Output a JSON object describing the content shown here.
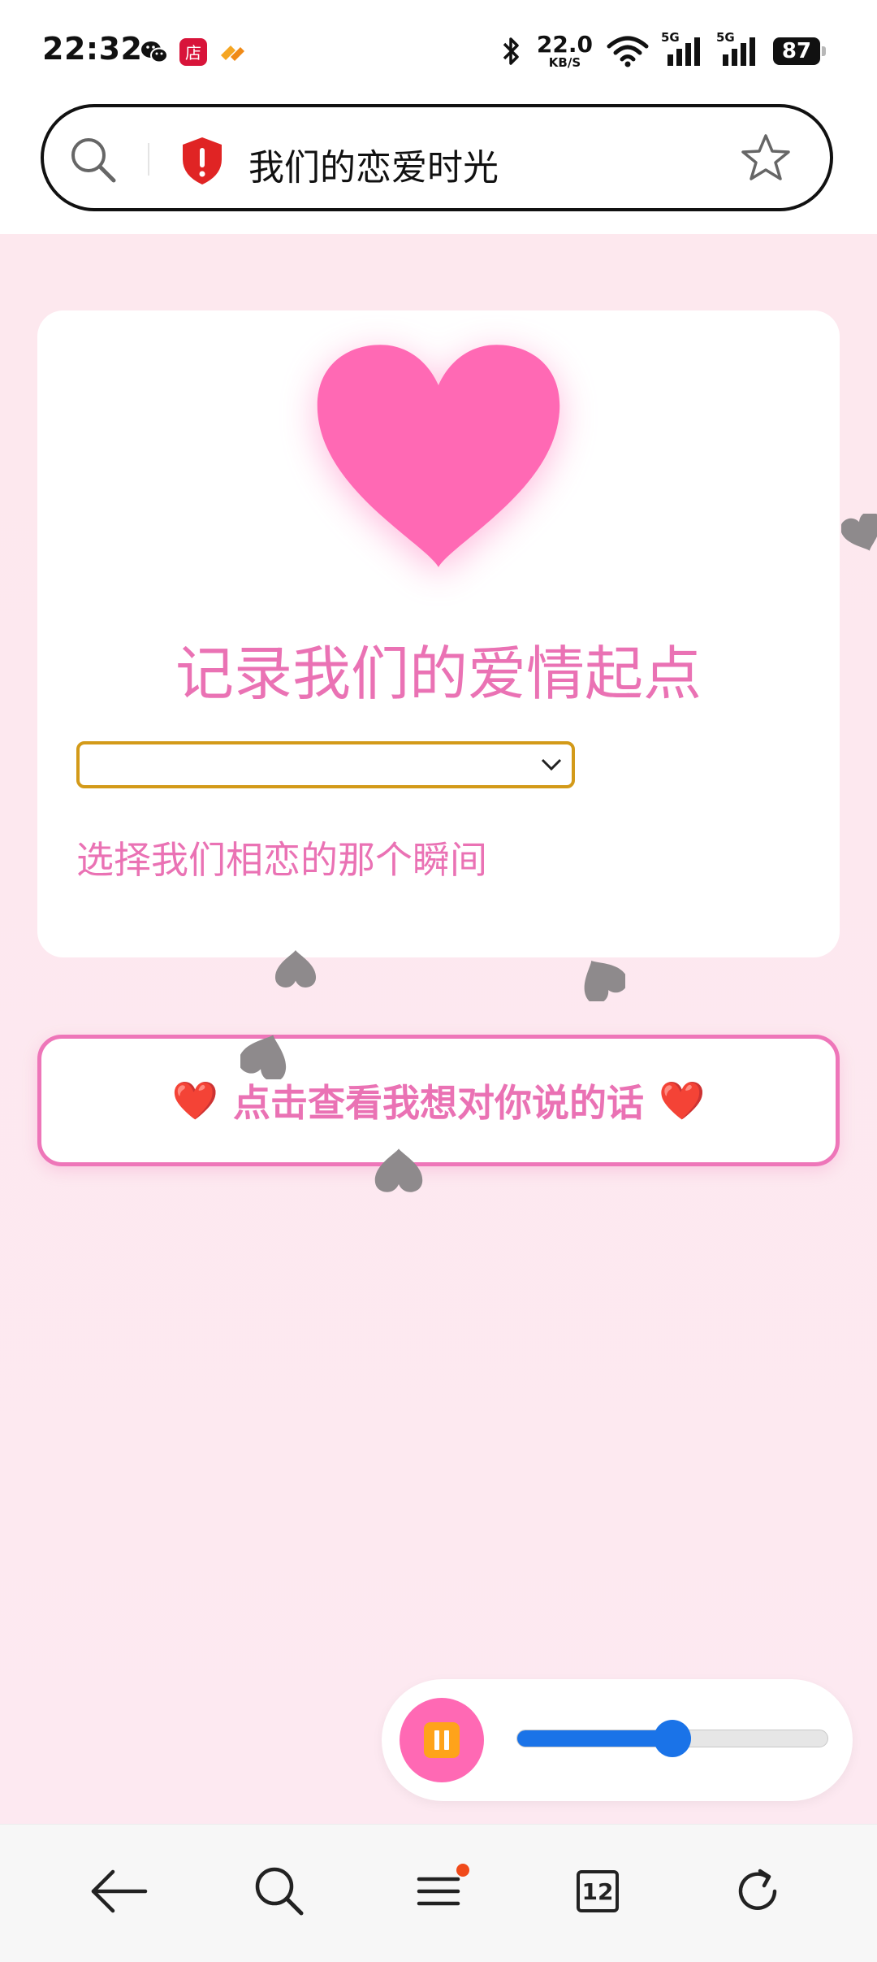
{
  "status_bar": {
    "time": "22:32",
    "net_speed_value": "22.0",
    "net_speed_unit": "KB/S",
    "signal_label_1": "5G",
    "signal_label_2": "5G",
    "battery_level": "87",
    "icons": [
      "wechat-icon",
      "store-app-icon",
      "orange-app-icon",
      "bluetooth-icon",
      "wifi-icon",
      "signal-icon",
      "battery-icon"
    ]
  },
  "address_bar": {
    "title": "我们的恋爱时光",
    "icons": [
      "search-icon",
      "shield-warning-icon",
      "star-icon"
    ]
  },
  "card": {
    "title": "记录我们的爱情起点",
    "date_value": "",
    "hint": "选择我们相恋的那个瞬间"
  },
  "message_button": {
    "label": "点击查看我想对你说的话",
    "heart_emoji": "❤️"
  },
  "music_player": {
    "play_state": "playing",
    "volume": 0.5
  },
  "bottom_nav": {
    "tabs_count": "12",
    "icons": [
      "back-arrow-icon",
      "search-icon",
      "menu-icon",
      "tabs-icon",
      "refresh-icon"
    ]
  },
  "colors": {
    "accent_pink": "#ea72b4",
    "heart_pink": "#ff69b4",
    "page_background": "#fde8ee",
    "select_border": "#d39a19",
    "slider_blue": "#1a73e8"
  }
}
